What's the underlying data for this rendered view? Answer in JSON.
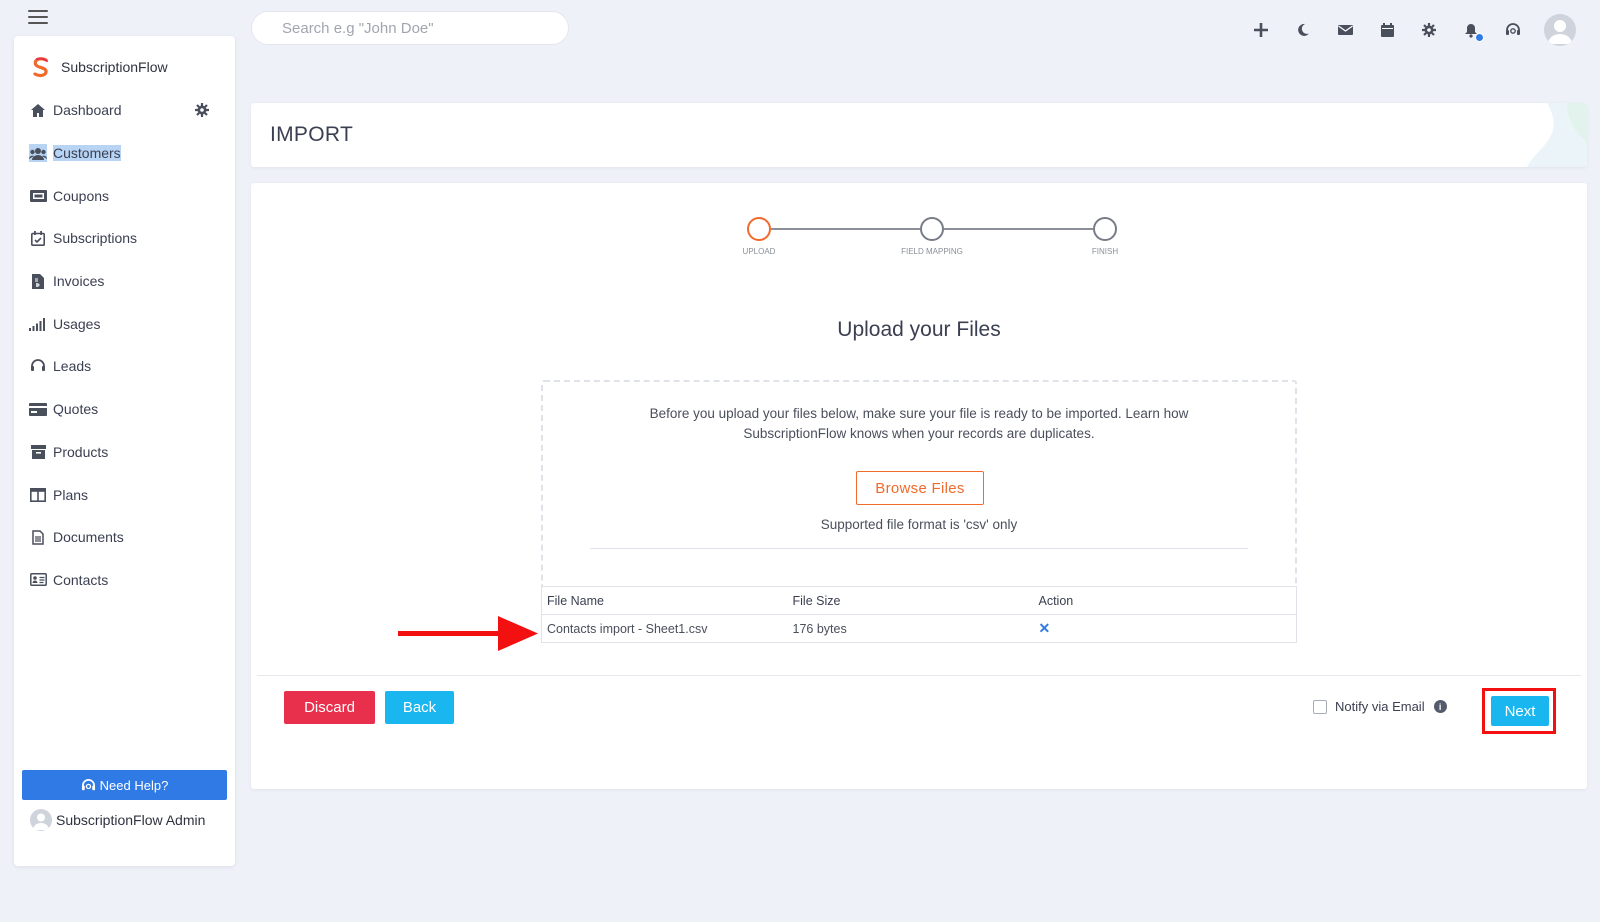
{
  "topbar": {
    "search_placeholder": "Search e.g \"John Doe\"",
    "icons": [
      "plus-icon",
      "moon-icon",
      "mail-icon",
      "calendar-icon",
      "gear-icon",
      "bell-icon",
      "headset-icon",
      "user-avatar"
    ]
  },
  "sidebar": {
    "brand": "SubscriptionFlow",
    "items": [
      {
        "label": "Dashboard",
        "icon": "home-icon"
      },
      {
        "label": "Customers",
        "icon": "users-icon"
      },
      {
        "label": "Coupons",
        "icon": "ticket-icon"
      },
      {
        "label": "Subscriptions",
        "icon": "calendar-check-icon"
      },
      {
        "label": "Invoices",
        "icon": "invoice-icon"
      },
      {
        "label": "Usages",
        "icon": "signal-icon"
      },
      {
        "label": "Leads",
        "icon": "headset-icon"
      },
      {
        "label": "Quotes",
        "icon": "card-icon"
      },
      {
        "label": "Products",
        "icon": "box-icon"
      },
      {
        "label": "Plans",
        "icon": "columns-icon"
      },
      {
        "label": "Documents",
        "icon": "document-icon"
      },
      {
        "label": "Contacts",
        "icon": "contact-card-icon"
      }
    ],
    "help_label": "Need Help?",
    "admin_name": "SubscriptionFlow Admin"
  },
  "page": {
    "title": "IMPORT"
  },
  "stepper": {
    "steps": [
      {
        "label": "UPLOAD",
        "state": "active"
      },
      {
        "label": "FIELD MAPPING",
        "state": "pending"
      },
      {
        "label": "FINISH",
        "state": "pending"
      }
    ]
  },
  "upload": {
    "title": "Upload your Files",
    "instructions": "Before you upload your files below, make sure your file is ready to be imported. Learn how SubscriptionFlow knows when your records are duplicates.",
    "browse_label": "Browse Files",
    "supported_text": "Supported file format is 'csv' only"
  },
  "file_table": {
    "headers": [
      "File Name",
      "File Size",
      "Action"
    ],
    "rows": [
      {
        "name": "Contacts import - Sheet1.csv",
        "size": "176 bytes",
        "action": "✕"
      }
    ]
  },
  "footer": {
    "discard_label": "Discard",
    "back_label": "Back",
    "notify_label": "Notify via Email",
    "notify_checked": false,
    "next_label": "Next"
  },
  "colors": {
    "accent_orange": "#ef6b2c",
    "primary_blue": "#2f7ae5",
    "cyan": "#1ab6f0",
    "danger": "#e8304d",
    "highlight_red": "#f21010"
  }
}
